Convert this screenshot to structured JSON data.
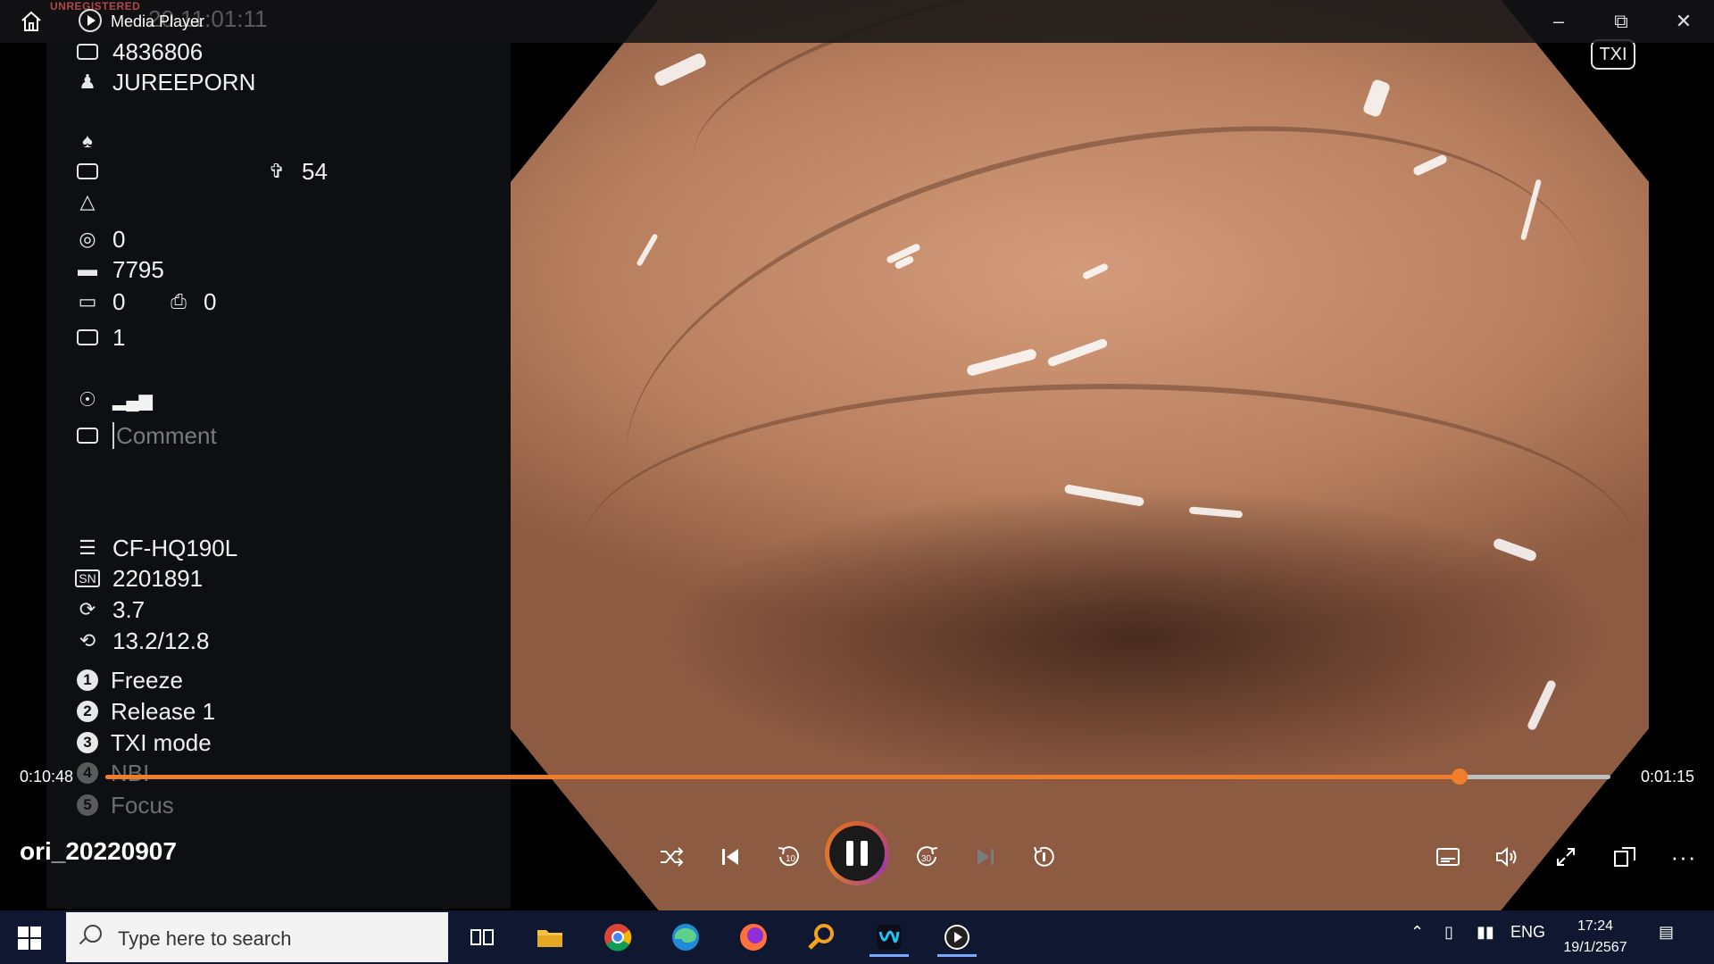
{
  "window": {
    "title": "Media Player",
    "watermark": "UNREGISTERED",
    "ghost_timestamp": "20 11:01:11",
    "txi_badge": "TXI"
  },
  "patient_info": {
    "id": "4836806",
    "name": "JUREEPORN",
    "age": "54",
    "capture_count": "0",
    "counter_value": "7795",
    "display_count": "0",
    "cvp_count": "0",
    "txi_value": "1",
    "comment_placeholder": "Comment"
  },
  "scope_info": {
    "model": "CF-HQ190L",
    "serial_label": "SN",
    "serial": "2201891",
    "rotation": "3.7",
    "angle": "13.2/12.8"
  },
  "function_buttons": [
    {
      "number": "1",
      "label": "Freeze"
    },
    {
      "number": "2",
      "label": "Release 1"
    },
    {
      "number": "3",
      "label": "TXI mode"
    },
    {
      "number": "4",
      "label": "NBI"
    },
    {
      "number": "5",
      "label": "Focus"
    }
  ],
  "playback": {
    "elapsed": "0:10:48",
    "remaining": "0:01:15",
    "progress_fraction": 0.9,
    "file_name": "ori_20220907",
    "accent_color": "#f07d2a",
    "skip_back_label": "10",
    "skip_forward_label": "30"
  },
  "taskbar": {
    "search_placeholder": "Type here to search",
    "language": "ENG",
    "time": "17:24",
    "date": "19/1/2567"
  }
}
